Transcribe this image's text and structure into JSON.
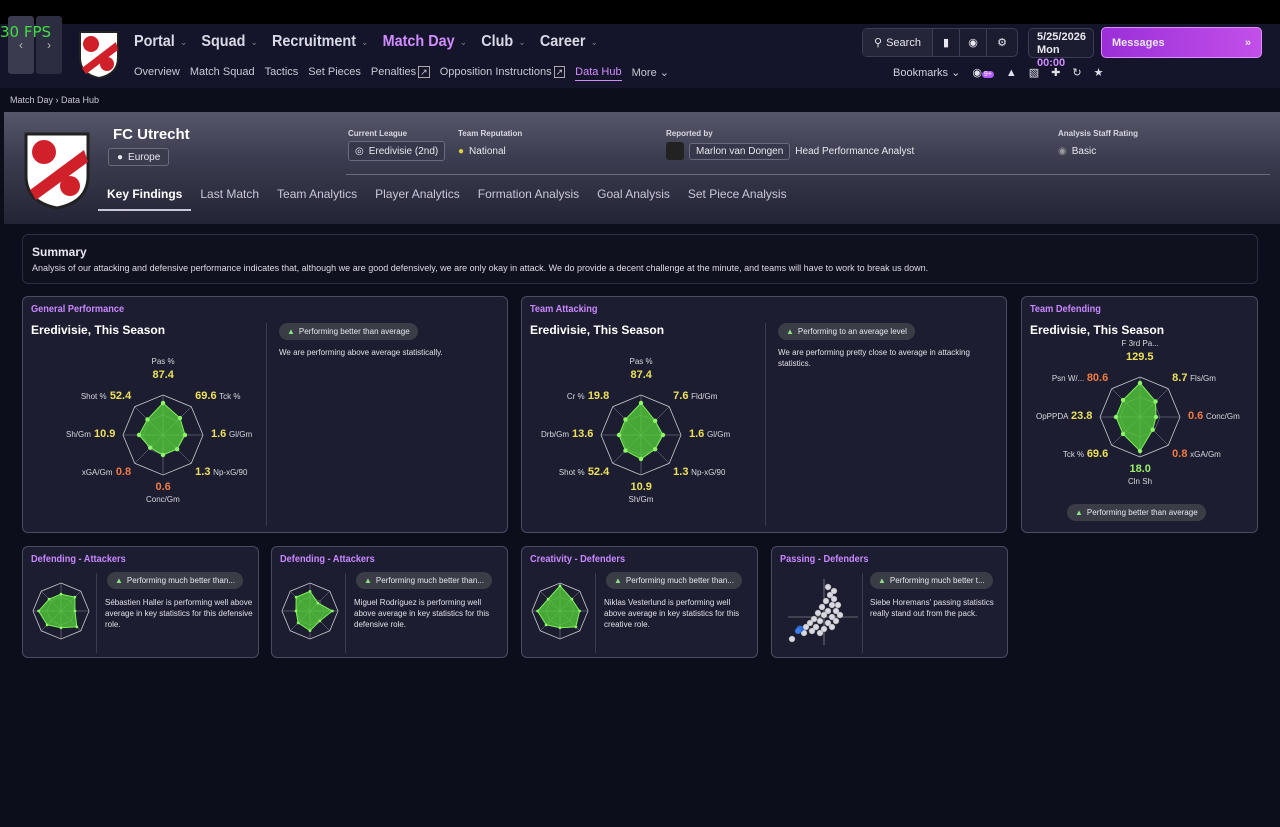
{
  "fps": "30 FPS",
  "colors": {
    "accent": "#d28cff",
    "good": "#9ef06a",
    "avg": "#ece05a",
    "bad": "#f07b42",
    "radar_fill": "#56d63a"
  },
  "nav": {
    "items": [
      {
        "label": "Portal",
        "active": false
      },
      {
        "label": "Squad",
        "active": false
      },
      {
        "label": "Recruitment",
        "active": false
      },
      {
        "label": "Match Day",
        "active": true
      },
      {
        "label": "Club",
        "active": false
      },
      {
        "label": "Career",
        "active": false
      }
    ],
    "subnav": [
      "Overview",
      "Match Squad",
      "Tactics",
      "Set Pieces",
      "Penalties",
      "Opposition Instructions",
      "Data Hub",
      "More"
    ],
    "search_label": "Search",
    "date": "5/25/2026",
    "day": "Mon",
    "time": "00:00",
    "messages_label": "Messages",
    "bookmarks_label": "Bookmarks",
    "badge": "9+"
  },
  "breadcrumb": {
    "parent": "Match Day",
    "current": "Data Hub"
  },
  "club": {
    "name": "FC Utrecht",
    "region": "Europe",
    "current_league_label": "Current League",
    "current_league": "Eredivisie (2nd)",
    "reputation_label": "Team Reputation",
    "reputation": "National",
    "reported_by_label": "Reported by",
    "reporter": "Marlon van Dongen",
    "reporter_role": "Head Performance Analyst",
    "staff_rating_label": "Analysis Staff Rating",
    "staff_rating": "Basic"
  },
  "tabs": [
    "Key Findings",
    "Last Match",
    "Team Analytics",
    "Player Analytics",
    "Formation Analysis",
    "Goal Analysis",
    "Set Piece Analysis"
  ],
  "summary": {
    "title": "Summary",
    "text": "Analysis of our attacking and defensive performance indicates that, although we are good defensively, we are only okay in attack. We do provide a decent challenge at the minute, and teams will have to work to break us down."
  },
  "cards": {
    "general": {
      "title": "General Performance",
      "subtitle": "Eredivisie, This Season",
      "pill": "Performing better than average",
      "desc": "We are performing above average statistically.",
      "radar": [
        {
          "label": "Pas %",
          "value": "87.4",
          "tone": "yellow",
          "r": 0.8
        },
        {
          "label": "Tck %",
          "value": "69.6",
          "tone": "yellow",
          "r": 0.6
        },
        {
          "label": "Gl/Gm",
          "value": "1.6",
          "tone": "yellow",
          "r": 0.55
        },
        {
          "label": "Np-xG/90",
          "value": "1.3",
          "tone": "yellow",
          "r": 0.5
        },
        {
          "label": "Conc/Gm",
          "value": "0.6",
          "tone": "orange",
          "r": 0.5
        },
        {
          "label": "xGA/Gm",
          "value": "0.8",
          "tone": "orange",
          "r": 0.45
        },
        {
          "label": "Sh/Gm",
          "value": "10.9",
          "tone": "yellow",
          "r": 0.6
        },
        {
          "label": "Shot %",
          "value": "52.4",
          "tone": "yellow",
          "r": 0.55
        }
      ]
    },
    "attacking": {
      "title": "Team Attacking",
      "subtitle": "Eredivisie, This Season",
      "pill": "Performing to an average level",
      "desc": "We are performing pretty close to average in attacking statistics.",
      "radar": [
        {
          "label": "Pas %",
          "value": "87.4",
          "tone": "yellow",
          "r": 0.8
        },
        {
          "label": "Fld/Gm",
          "value": "7.6",
          "tone": "yellow",
          "r": 0.5
        },
        {
          "label": "Gl/Gm",
          "value": "1.6",
          "tone": "yellow",
          "r": 0.55
        },
        {
          "label": "Np-xG/90",
          "value": "1.3",
          "tone": "yellow",
          "r": 0.5
        },
        {
          "label": "Sh/Gm",
          "value": "10.9",
          "tone": "yellow",
          "r": 0.6
        },
        {
          "label": "Shot %",
          "value": "52.4",
          "tone": "yellow",
          "r": 0.55
        },
        {
          "label": "Drb/Gm",
          "value": "13.6",
          "tone": "yellow",
          "r": 0.55
        },
        {
          "label": "Cr %",
          "value": "19.8",
          "tone": "yellow",
          "r": 0.55
        }
      ]
    },
    "defending": {
      "title": "Team Defending",
      "subtitle": "Eredivisie, This Season",
      "pill": "Performing better than average",
      "radar": [
        {
          "label": "F 3rd Pa...",
          "value": "129.5",
          "tone": "yellow",
          "r": 0.85
        },
        {
          "label": "Fls/Gm",
          "value": "8.7",
          "tone": "yellow",
          "r": 0.55
        },
        {
          "label": "Conc/Gm",
          "value": "0.6",
          "tone": "orange",
          "r": 0.4
        },
        {
          "label": "xGA/Gm",
          "value": "0.8",
          "tone": "orange",
          "r": 0.45
        },
        {
          "label": "Cln Sh",
          "value": "18.0",
          "tone": "green",
          "r": 0.85
        },
        {
          "label": "Tck %",
          "value": "69.6",
          "tone": "yellow",
          "r": 0.6
        },
        {
          "label": "OpPPDA",
          "value": "23.8",
          "tone": "yellow",
          "r": 0.6
        },
        {
          "label": "Psn W/...",
          "value": "80.6",
          "tone": "orange",
          "r": 0.6
        }
      ]
    },
    "small": [
      {
        "title": "Defending - Attackers",
        "pill": "Performing much better than...",
        "desc": "Sébastien Haller is performing well above average in key statistics for this defensive role.",
        "r": [
          0.6,
          0.7,
          0.5,
          0.8,
          0.6,
          0.7,
          0.8,
          0.6
        ]
      },
      {
        "title": "Defending - Attackers",
        "pill": "Performing much better than...",
        "desc": "Miguel Rodríguez is performing well above average in key statistics for this defensive role.",
        "r": [
          0.7,
          0.4,
          0.8,
          0.5,
          0.7,
          0.6,
          0.5,
          0.7
        ]
      },
      {
        "title": "Creativity - Defenders",
        "pill": "Performing much better than...",
        "desc": "Niklas Vesterlund is performing well above average in key statistics for this creative role.",
        "r": [
          0.9,
          0.6,
          0.7,
          0.8,
          0.6,
          0.7,
          0.8,
          0.6
        ]
      },
      {
        "title": "Passing - Defenders",
        "pill": "Performing much better t...",
        "desc": "Siebe Horemans' passing statistics really stand out from the pack."
      }
    ]
  }
}
